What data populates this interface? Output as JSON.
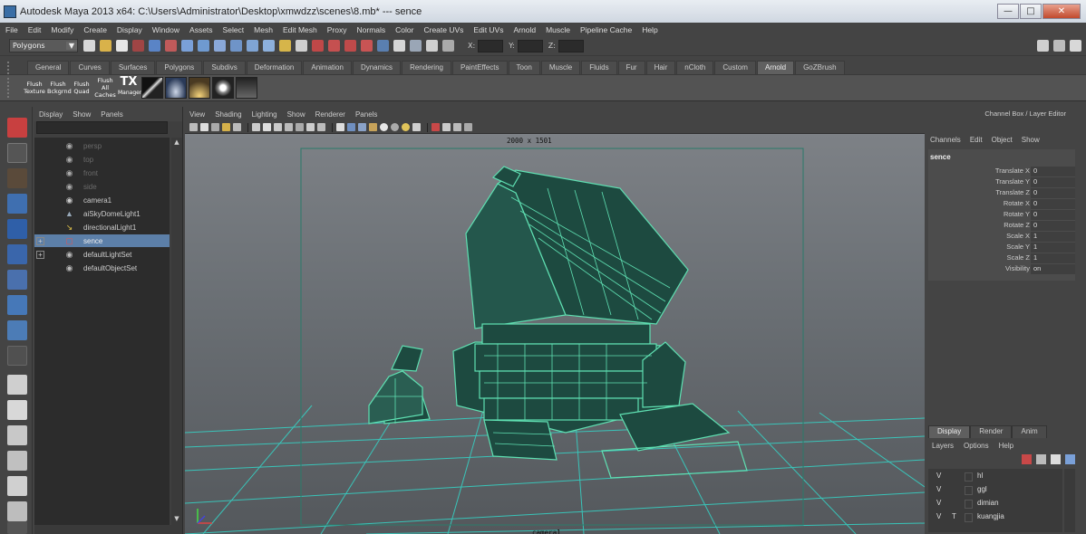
{
  "window": {
    "title": "Autodesk Maya 2013 x64: C:\\Users\\Administrator\\Desktop\\xmwdzz\\scenes\\8.mb*   ---   sence"
  },
  "menubar": {
    "items": [
      "File",
      "Edit",
      "Modify",
      "Create",
      "Display",
      "Window",
      "Assets",
      "Select",
      "Mesh",
      "Edit Mesh",
      "Proxy",
      "Normals",
      "Color",
      "Create UVs",
      "Edit UVs",
      "Arnold",
      "Muscle",
      "Pipeline Cache",
      "Help"
    ]
  },
  "statusline": {
    "mode": "Polygons",
    "x_label": "X:",
    "y_label": "Y:",
    "z_label": "Z:"
  },
  "shelf": {
    "tabs": [
      "General",
      "Curves",
      "Surfaces",
      "Polygons",
      "Subdivs",
      "Deformation",
      "Animation",
      "Dynamics",
      "Rendering",
      "PaintEffects",
      "Toon",
      "Muscle",
      "Fluids",
      "Fur",
      "Hair",
      "nCloth",
      "Custom",
      "Arnold",
      "GoZBrush"
    ],
    "active_tab": "Arnold",
    "buttons": [
      {
        "line1": "Flush",
        "line2": "Texture"
      },
      {
        "line1": "Flush",
        "line2": "Bckgrnd"
      },
      {
        "line1": "Flush",
        "line2": "Quad"
      },
      {
        "line1": "Flush",
        "line2": "All Caches"
      },
      {
        "line1": "TX",
        "line2": "Manager"
      }
    ]
  },
  "outliner": {
    "menu": [
      "Display",
      "Show",
      "Panels"
    ],
    "items": [
      {
        "label": "persp",
        "dim": true,
        "icon": "camera-icon"
      },
      {
        "label": "top",
        "dim": true,
        "icon": "camera-icon"
      },
      {
        "label": "front",
        "dim": true,
        "icon": "camera-icon"
      },
      {
        "label": "side",
        "dim": true,
        "icon": "camera-icon"
      },
      {
        "label": "camera1",
        "dim": false,
        "icon": "camera-icon"
      },
      {
        "label": "aiSkyDomeLight1",
        "dim": false,
        "icon": "skydome-light-icon"
      },
      {
        "label": "directionalLight1",
        "dim": false,
        "icon": "directional-light-icon"
      },
      {
        "label": "sence",
        "dim": false,
        "selected": true,
        "expand": true,
        "icon": "group-icon"
      },
      {
        "label": "defaultLightSet",
        "dim": false,
        "expand": true,
        "icon": "set-icon"
      },
      {
        "label": "defaultObjectSet",
        "dim": false,
        "icon": "set-icon"
      }
    ]
  },
  "viewport": {
    "menu": [
      "View",
      "Shading",
      "Lighting",
      "Show",
      "Renderer",
      "Panels"
    ],
    "resolution_label": "2000 x 1501",
    "camera_label": "camera1",
    "wire_color": "#5fe0b2",
    "grid_color": "#34d6c8"
  },
  "channelbox": {
    "title": "Channel Box / Layer Editor",
    "menu": [
      "Channels",
      "Edit",
      "Object",
      "Show"
    ],
    "object_name": "sence",
    "attributes": [
      {
        "name": "Translate X",
        "value": "0"
      },
      {
        "name": "Translate Y",
        "value": "0"
      },
      {
        "name": "Translate Z",
        "value": "0"
      },
      {
        "name": "Rotate X",
        "value": "0"
      },
      {
        "name": "Rotate Y",
        "value": "0"
      },
      {
        "name": "Rotate Z",
        "value": "0"
      },
      {
        "name": "Scale X",
        "value": "1"
      },
      {
        "name": "Scale Y",
        "value": "1"
      },
      {
        "name": "Scale Z",
        "value": "1"
      },
      {
        "name": "Visibility",
        "value": "on"
      }
    ]
  },
  "layereditor": {
    "tabs": [
      "Display",
      "Render",
      "Anim"
    ],
    "active_tab": "Display",
    "menu": [
      "Layers",
      "Options",
      "Help"
    ],
    "layers": [
      {
        "v": "V",
        "t": "",
        "name": "hl"
      },
      {
        "v": "V",
        "t": "",
        "name": "ggl"
      },
      {
        "v": "V",
        "t": "",
        "name": "dimian"
      },
      {
        "v": "V",
        "t": "T",
        "name": "kuangjia"
      }
    ]
  },
  "colors": {
    "accent_selection": "#5c7fa8",
    "wireframe": "#5fe0b2"
  }
}
